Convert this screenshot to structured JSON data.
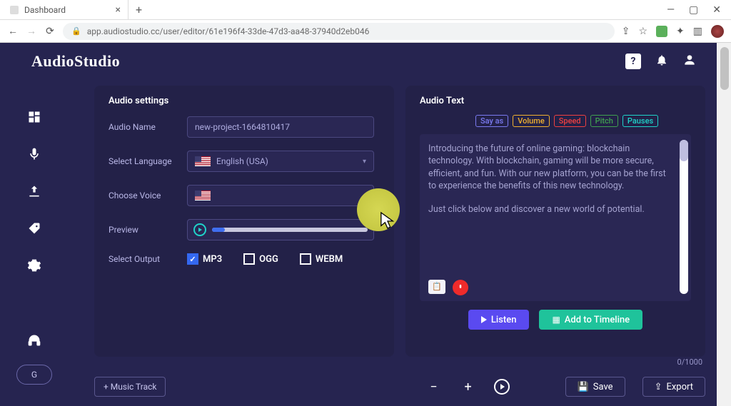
{
  "browser": {
    "tab_title": "Dashboard",
    "url": "app.audiostudio.cc/user/editor/61e196f4-33de-47d3-aa48-37940d2eb046"
  },
  "brand": "AudioStudio",
  "sidebar": {
    "g_label": "G"
  },
  "settings": {
    "title": "Audio settings",
    "audio_name_label": "Audio Name",
    "audio_name_value": "new-project-1664810417",
    "language_label": "Select Language",
    "language_value": "English (USA)",
    "voice_label": "Choose Voice",
    "voice_value": "",
    "preview_label": "Preview",
    "output_label": "Select Output",
    "outputs": [
      {
        "label": "MP3",
        "checked": true
      },
      {
        "label": "OGG",
        "checked": false
      },
      {
        "label": "WEBM",
        "checked": false
      }
    ]
  },
  "text_panel": {
    "title": "Audio Text",
    "tags": {
      "say_as": "Say as",
      "volume": "Volume",
      "speed": "Speed",
      "pitch": "Pitch",
      "pauses": "Pauses"
    },
    "para1": "Introducing the future of online gaming: blockchain technology. With blockchain, gaming will be more secure, efficient, and fun. With our new platform, you can be the first to experience the benefits of this new technology.",
    "para2": "Just click below and discover a new world of potential.",
    "char_count": "0/1000",
    "listen_label": "Listen",
    "timeline_label": "Add to Timeline"
  },
  "toolbar": {
    "music_track": "+ Music Track",
    "save": "Save",
    "export": "Export"
  }
}
